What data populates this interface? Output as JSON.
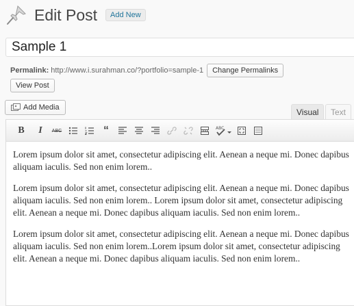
{
  "header": {
    "title": "Edit Post",
    "add_new_label": "Add New"
  },
  "post": {
    "title_value": "Sample 1"
  },
  "permalink": {
    "label": "Permalink:",
    "url": "http://www.i.surahman.co/?portfolio=sample-1",
    "change_button": "Change Permalinks",
    "view_button": "View Post"
  },
  "media": {
    "add_media_label": "Add Media"
  },
  "tabs": {
    "visual": "Visual",
    "text": "Text"
  },
  "toolbar": {
    "buttons": [
      {
        "icon": "bold-icon",
        "glyph": "B"
      },
      {
        "icon": "italic-icon",
        "glyph": "I"
      },
      {
        "icon": "strikethrough-icon",
        "glyph": "ABC"
      },
      {
        "icon": "bullet-list-icon"
      },
      {
        "icon": "numbered-list-icon"
      },
      {
        "icon": "blockquote-icon",
        "glyph": "“"
      },
      {
        "icon": "align-left-icon"
      },
      {
        "icon": "align-center-icon"
      },
      {
        "icon": "align-right-icon"
      },
      {
        "icon": "insert-link-icon"
      },
      {
        "icon": "unlink-icon"
      },
      {
        "icon": "read-more-icon"
      },
      {
        "icon": "spellcheck-icon",
        "glyph": "ABC"
      },
      {
        "icon": "fullscreen-icon"
      },
      {
        "icon": "kitchen-sink-icon"
      }
    ]
  },
  "content": {
    "paragraphs": [
      "Lorem ipsum dolor sit amet, consectetur adipiscing elit. Aenean a neque mi. Donec dapibus aliquam iaculis. Sed non enim lorem..",
      "Lorem ipsum dolor sit amet, consectetur adipiscing elit. Aenean a neque mi. Donec dapibus aliquam iaculis. Sed non enim lorem.. Lorem ipsum dolor sit amet, consectetur adipiscing elit. Aenean a neque mi. Donec dapibus aliquam iaculis. Sed non enim lorem..",
      "Lorem ipsum dolor sit amet, consectetur adipiscing elit. Aenean a neque mi. Donec dapibus aliquam iaculis. Sed non enim lorem..Lorem ipsum dolor sit amet, consectetur adipiscing elit. Aenean a neque mi. Donec dapibus aliquam iaculis. Sed non enim lorem.."
    ]
  },
  "colors": {
    "link": "#21759b",
    "spellcheck_underline": "#cc0000"
  }
}
